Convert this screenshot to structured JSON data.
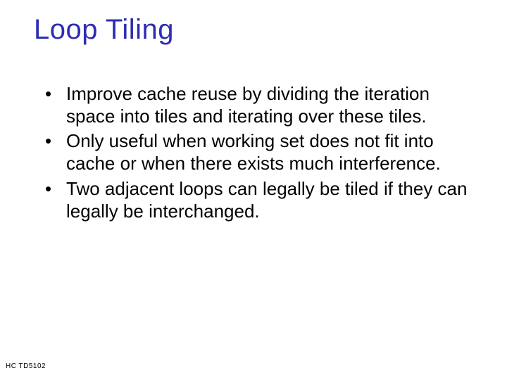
{
  "title": "Loop Tiling",
  "bullets": [
    "Improve cache reuse by dividing the iteration space into tiles and iterating over these tiles.",
    "Only useful when working set does not fit into cache or when there exists much interference.",
    "Two adjacent loops can legally be tiled if they can legally be interchanged."
  ],
  "footer": "HC  TD5102"
}
